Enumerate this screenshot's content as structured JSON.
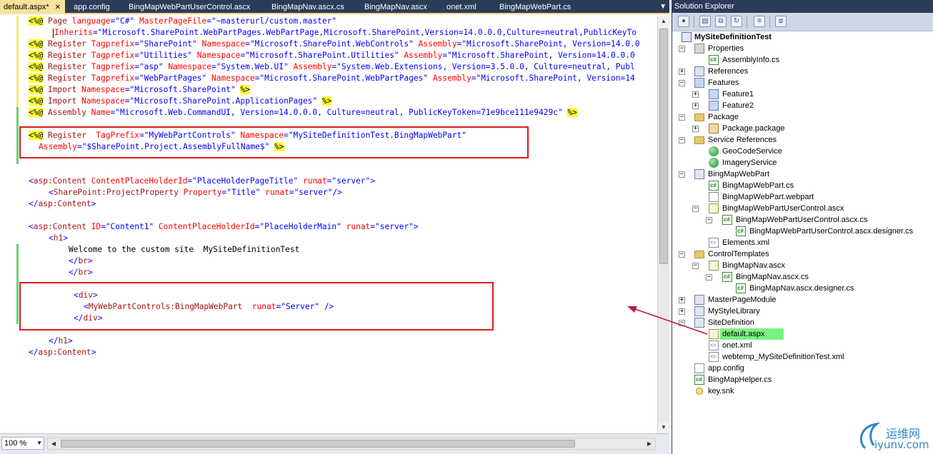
{
  "tabs": [
    {
      "label": "default.aspx*",
      "active": true
    },
    {
      "label": "app.config"
    },
    {
      "label": "BingMapWebPartUserControl.ascx"
    },
    {
      "label": "BingMapNav.ascx.cs"
    },
    {
      "label": "BingMapNav.ascx"
    },
    {
      "label": "onet.xml"
    },
    {
      "label": "BingMapWebPart.cs"
    }
  ],
  "code": {
    "l1": [
      "<%@",
      " Page ",
      "language",
      "=\"C#\" ",
      "MasterPageFile",
      "=\"~masterurl/custom.master\""
    ],
    "l2": [
      "Inherits",
      "=\"Microsoft.SharePoint.WebPartPages.WebPartPage,Microsoft.SharePoint,Version=14.0.0.0,Culture=neutral,PublicKeyTo"
    ],
    "l3": [
      "<%@",
      " Register ",
      "Tagprefix",
      "=\"SharePoint\" ",
      "Namespace",
      "=\"Microsoft.SharePoint.WebControls\" ",
      "Assembly",
      "=\"Microsoft.SharePoint, Version=14.0.0"
    ],
    "l4": [
      "<%@",
      " Register ",
      "Tagprefix",
      "=\"Utilities\" ",
      "Namespace",
      "=\"Microsoft.SharePoint.Utilities\" ",
      "Assembly",
      "=\"Microsoft.SharePoint, Version=14.0.0.0"
    ],
    "l5": [
      "<%@",
      " Register ",
      "Tagprefix",
      "=\"asp\" ",
      "Namespace",
      "=\"System.Web.UI\" ",
      "Assembly",
      "=\"System.Web.Extensions, Version=3.5.0.0, Culture=neutral, Publ"
    ],
    "l6": [
      "<%@",
      " Register ",
      "Tagprefix",
      "=\"WebPartPages\" ",
      "Namespace",
      "=\"Microsoft.SharePoint.WebPartPages\" ",
      "Assembly",
      "=\"Microsoft.SharePoint, Version=14"
    ],
    "l7": [
      "<%@",
      " Import ",
      "Namespace",
      "=\"Microsoft.SharePoint\" ",
      "%>"
    ],
    "l8": [
      "<%@",
      " Import ",
      "Namespace",
      "=\"Microsoft.SharePoint.ApplicationPages\" ",
      "%>"
    ],
    "l9": [
      "<%@",
      " Assembly ",
      "Name",
      "=\"Microsoft.Web.CommandUI, Version=14.0.0.0, Culture=neutral, PublicKeyToken=71e9bce111e9429c\" ",
      "%>"
    ],
    "l11": [
      "<%@",
      " Register  ",
      "TagPrefix",
      "=\"MyWebPartControls\" ",
      "Namespace",
      "=\"MySiteDefinitionTest.BingMapWebPart\""
    ],
    "l12": [
      "Assembly",
      "=\"$SharePoint.Project.AssemblyFullName$\" ",
      "%>"
    ],
    "l15": [
      "<",
      "asp:Content",
      " ",
      "ContentPlaceHolderId",
      "=\"PlaceHolderPageTitle\" ",
      "runat",
      "=\"server\">"
    ],
    "l16": [
      "<",
      "SharePoint:ProjectProperty",
      " ",
      "Property",
      "=\"Title\" ",
      "runat",
      "=\"server\"/>"
    ],
    "l17": [
      "</",
      "asp:Content",
      ">"
    ],
    "l19": [
      "<",
      "asp:Content",
      " ",
      "ID",
      "=\"Content1\" ",
      "ContentPlaceHolderId",
      "=\"PlaceHolderMain\" ",
      "runat",
      "=\"server\">"
    ],
    "l20": [
      "<",
      "h1",
      ">"
    ],
    "l21": [
      "Welcome to the custom site  MySiteDefinitionTest"
    ],
    "l22": [
      "</",
      "br",
      ">"
    ],
    "l23": [
      "</",
      "br",
      ">"
    ],
    "l25": [
      "<",
      "div",
      ">"
    ],
    "l26": [
      "<",
      "MyWebPartControls:BingMapWebPart",
      "  ",
      "runat",
      "=\"Server\" />"
    ],
    "l27": [
      "</",
      "div",
      ">"
    ],
    "l29": [
      "</",
      "h1",
      ">"
    ],
    "l30": [
      "</",
      "asp:Content",
      ">"
    ]
  },
  "zoom": "100 %",
  "solution_explorer": {
    "title": "Solution Explorer",
    "tree": [
      {
        "label": "MySiteDefinitionTest",
        "bold": true
      },
      {
        "label": "Properties"
      },
      {
        "label": "AssemblyInfo.cs"
      },
      {
        "label": "References"
      },
      {
        "label": "Features"
      },
      {
        "label": "Feature1"
      },
      {
        "label": "Feature2"
      },
      {
        "label": "Package"
      },
      {
        "label": "Package.package"
      },
      {
        "label": "Service References"
      },
      {
        "label": "GeoCodeService"
      },
      {
        "label": "ImageryService"
      },
      {
        "label": "BingMapWebPart"
      },
      {
        "label": "BingMapWebPart.cs"
      },
      {
        "label": "BingMapWebPart.webpart"
      },
      {
        "label": "BingMapWebPartUserControl.ascx"
      },
      {
        "label": "BingMapWebPartUserControl.ascx.cs"
      },
      {
        "label": "BingMapWebPartUserControl.ascx.designer.cs"
      },
      {
        "label": "Elements.xml"
      },
      {
        "label": "ControlTemplates"
      },
      {
        "label": "BingMapNav.ascx"
      },
      {
        "label": "BingMapNav.ascx.cs"
      },
      {
        "label": "BingMapNav.ascx.designer.cs"
      },
      {
        "label": "MasterPageModule"
      },
      {
        "label": "MyStyleLibrary"
      },
      {
        "label": "SiteDefinition"
      },
      {
        "label": "default.aspx",
        "selected": true
      },
      {
        "label": "onet.xml"
      },
      {
        "label": "webtemp_MySiteDefinitionTest.xml"
      },
      {
        "label": "app.config"
      },
      {
        "label": "BingMapHelper.cs"
      },
      {
        "label": "key.snk"
      }
    ]
  },
  "watermark": {
    "cn": "运维网",
    "en": "iyunv.com"
  },
  "colors": {
    "tabbar": "#2b3c59",
    "active_tab": "#f7e29c",
    "directive_highlight": "#ffff33",
    "tag": "#a31515",
    "attribute": "#ff0000",
    "value": "#0000ff",
    "annotation_red": "#e01b1b",
    "selected_node": "#7bf17f"
  }
}
